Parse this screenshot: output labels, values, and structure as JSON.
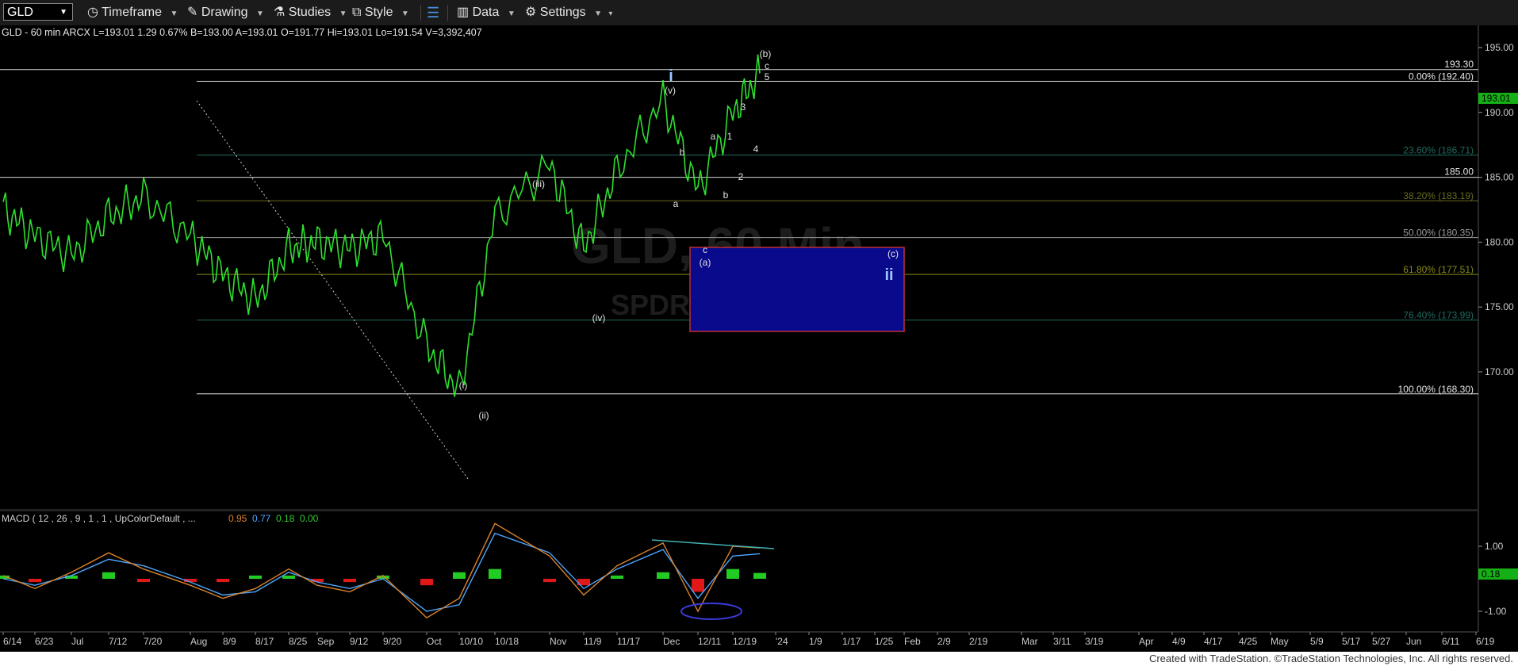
{
  "toolbar": {
    "symbol": "GLD",
    "timeframe_label": "Timeframe",
    "drawing_label": "Drawing",
    "studies_label": "Studies",
    "style_label": "Style",
    "data_label": "Data",
    "settings_label": "Settings"
  },
  "header": {
    "info": "GLD - 60 min  ARCX  L=193.01  1.29  0.67%  B=193.00  A=193.01  O=191.77  Hi=193.01  Lo=191.54  V=3,392,407"
  },
  "price_axis": {
    "ticks": [
      "195.00",
      "190.00",
      "185.00",
      "180.00",
      "175.00",
      "170.00"
    ],
    "tick_values": [
      195,
      190,
      185,
      180,
      175,
      170
    ],
    "last_price": "193.01"
  },
  "fib_levels": [
    {
      "label": "0.00% (192.40)",
      "value": 192.4,
      "color": "#e8e8e8"
    },
    {
      "label": "23.60% (186.71)",
      "value": 186.71,
      "color": "#1f6b60"
    },
    {
      "label": "38.20% (183.19)",
      "value": 183.19,
      "color": "#6b6b1f"
    },
    {
      "label": "50.00% (180.35)",
      "value": 180.35,
      "color": "#9a9a9a"
    },
    {
      "label": "61.80% (177.51)",
      "value": 177.51,
      "color": "#8a8a1a"
    },
    {
      "label": "76.40% (173.99)",
      "value": 173.99,
      "color": "#1f6b60"
    },
    {
      "label": "100.00% (168.30)",
      "value": 168.3,
      "color": "#e8e8e8"
    }
  ],
  "horizontal_lines": [
    {
      "label": "193.30",
      "value": 193.3
    },
    {
      "label": "185.00",
      "value": 185.0
    }
  ],
  "watermark": {
    "symbol": "GLD, 60 Min",
    "name": "SPDR"
  },
  "wave_labels": [
    {
      "text": "i",
      "major": true
    },
    {
      "text": "(b)"
    },
    {
      "text": "c"
    },
    {
      "text": "5"
    },
    {
      "text": "(v)"
    },
    {
      "text": "3"
    },
    {
      "text": "a"
    },
    {
      "text": "1"
    },
    {
      "text": "b"
    },
    {
      "text": "4"
    },
    {
      "text": "2"
    },
    {
      "text": "a"
    },
    {
      "text": "b"
    },
    {
      "text": "(iii)"
    },
    {
      "text": "c"
    },
    {
      "text": "(a)"
    },
    {
      "text": "(c)"
    },
    {
      "text": "ii",
      "major": true
    },
    {
      "text": "(iv)"
    },
    {
      "text": "(i)"
    },
    {
      "text": "(ii)"
    }
  ],
  "macd": {
    "label": "MACD ( 12 , 26 , 9 , 1 , 1 , UpColorDefault , ...",
    "values": [
      "0.95",
      "0.77",
      "0.18",
      "0.00"
    ],
    "value_colors": [
      "#d9822b",
      "#4da6ff",
      "#33cc33",
      "#33cc33"
    ],
    "ticks": [
      "1.00",
      "-1.00"
    ],
    "current": "0.18"
  },
  "date_axis": [
    "6/14",
    "6/23",
    "Jul",
    "7/12",
    "7/20",
    "Aug",
    "8/9",
    "8/17",
    "8/25",
    "Sep",
    "9/12",
    "9/20",
    "Oct",
    "10/10",
    "10/18",
    "Nov",
    "11/9",
    "11/17",
    "Dec",
    "12/11",
    "12/19",
    "'24",
    "1/9",
    "1/17",
    "1/25",
    "Feb",
    "2/9",
    "2/19",
    "Mar",
    "3/11",
    "3/19",
    "Apr",
    "4/9",
    "4/17",
    "4/25",
    "May",
    "5/9",
    "5/17",
    "5/27",
    "Jun",
    "6/11",
    "6/19"
  ],
  "footer": {
    "credit": "Created with TradeStation. ©TradeStation Technologies, Inc. All rights reserved."
  },
  "chart_data": {
    "type": "line",
    "title": "GLD - 60 min",
    "x": [
      "6/14",
      "6/23",
      "Jul",
      "7/12",
      "7/20",
      "Aug",
      "8/9",
      "8/17",
      "8/25",
      "Sep",
      "9/12",
      "9/20",
      "Oct",
      "10/10",
      "10/18",
      "Nov",
      "11/9",
      "11/17",
      "Dec",
      "12/11",
      "12/19",
      "12/27"
    ],
    "series": [
      {
        "values": [
          182.5,
          180.5,
          179,
          182,
          183.5,
          180.5,
          177.5,
          175.5,
          179.5,
          180,
          179.5,
          180.5,
          172,
          168.5,
          182,
          186,
          179.5,
          185.5,
          191,
          184,
          190,
          193.01
        ]
      }
    ],
    "ylim": [
      167,
      197.5
    ],
    "grid": false,
    "macd": {
      "x": [
        "6/14",
        "6/23",
        "Jul",
        "7/12",
        "7/20",
        "Aug",
        "8/9",
        "8/17",
        "8/25",
        "Sep",
        "9/12",
        "9/20",
        "Oct",
        "10/10",
        "10/18",
        "Nov",
        "11/9",
        "11/17",
        "Dec",
        "12/11",
        "12/19",
        "12/27"
      ],
      "macd_line": [
        0.1,
        -0.3,
        0.2,
        0.8,
        0.3,
        -0.2,
        -0.6,
        -0.3,
        0.3,
        -0.2,
        -0.4,
        0.1,
        -1.2,
        -0.6,
        1.7,
        0.7,
        -0.5,
        0.4,
        1.1,
        -1.0,
        1.0,
        0.95
      ],
      "signal_line": [
        0.0,
        -0.2,
        0.1,
        0.6,
        0.4,
        -0.1,
        -0.5,
        -0.4,
        0.2,
        -0.1,
        -0.3,
        0.0,
        -1.0,
        -0.8,
        1.4,
        0.8,
        -0.3,
        0.3,
        0.9,
        -0.6,
        0.7,
        0.77
      ],
      "histogram": [
        0.1,
        -0.1,
        0.1,
        0.2,
        -0.1,
        -0.1,
        -0.1,
        0.1,
        0.1,
        -0.1,
        -0.1,
        0.1,
        -0.2,
        0.2,
        0.3,
        -0.1,
        -0.2,
        0.1,
        0.2,
        -0.4,
        0.3,
        0.18
      ],
      "ylim": [
        -1.5,
        2.0
      ]
    }
  }
}
